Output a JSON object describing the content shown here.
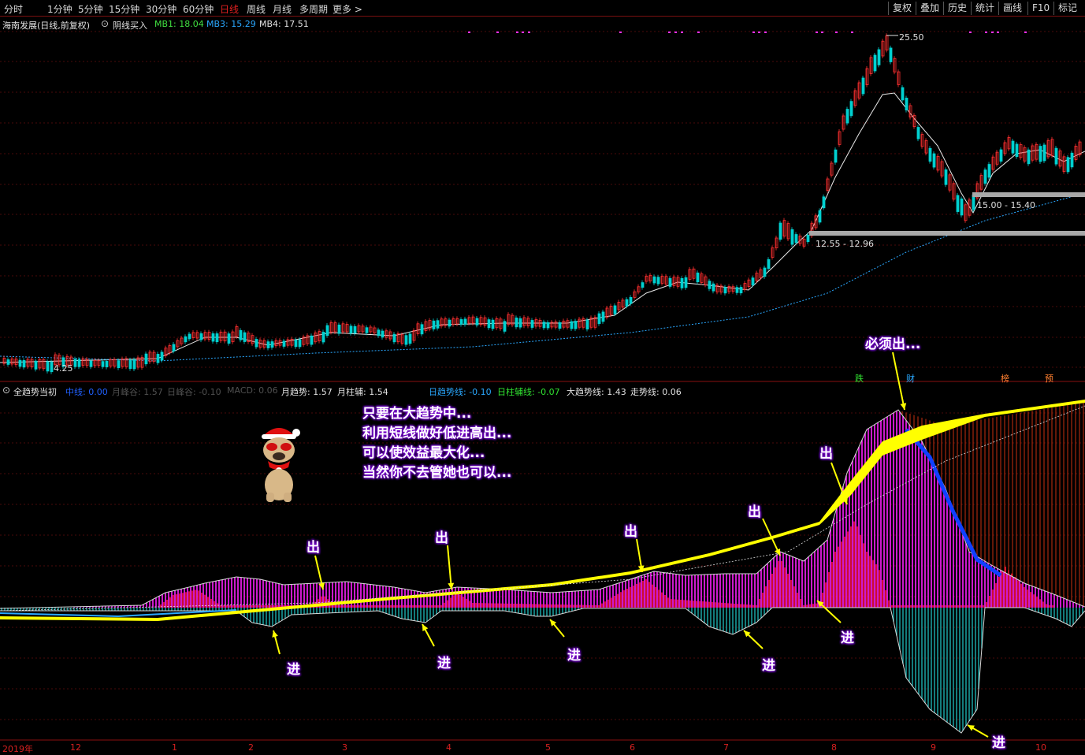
{
  "toolbar": {
    "periods": [
      "分时",
      "1分钟",
      "5分钟",
      "15分钟",
      "30分钟",
      "60分钟",
      "日线",
      "周线",
      "月线",
      "多周期",
      "更多 >"
    ],
    "active_period": "日线",
    "right_buttons": [
      "复权",
      "叠加",
      "历史",
      "统计",
      "画线",
      "F10",
      "标记"
    ]
  },
  "main_header": {
    "stock": "海南发展(日线,前复权)",
    "indicator": "阴线买入",
    "mb1": "MB1: 18.04",
    "mb3": "MB3: 15.29",
    "mb4": "MB4: 17.51"
  },
  "price_labels": {
    "high": "25.50",
    "low": "4.25",
    "zone1": "12.55 - 12.96",
    "zone2": "15.00 - 15.40"
  },
  "event_tags": [
    "跌",
    "财",
    "榜",
    "预"
  ],
  "sub_header": {
    "title": "全趋势当初",
    "zx": "中线: 0.00",
    "yfg": "月峰谷: 1.57",
    "rfg": "日峰谷: -0.10",
    "macd": "MACD: 0.06",
    "yqs": "月趋势: 1.57",
    "yzf": "月柱辅: 1.54",
    "rqsx": "日趋势线: -0.10",
    "rzfx": "日柱辅线: -0.07",
    "dqsx": "大趋势线: 1.43",
    "zsx": "走势线: 0.06"
  },
  "annotations": {
    "note_lines": [
      "只要在大趋势中...",
      "利用短线做好低进高出...",
      "可以使效益最大化...",
      "当然你不去管她也可以..."
    ],
    "must_sell": "必须出...",
    "sell": "出",
    "buy": "进"
  },
  "x_axis": {
    "year": "2019年",
    "months": [
      "12",
      "1",
      "2",
      "3",
      "4",
      "5",
      "6",
      "7",
      "8",
      "9",
      "10"
    ]
  },
  "colors": {
    "up": "#ff3030",
    "down": "#00d0d0",
    "ma_white": "#e8e8e8",
    "ma_blue": "#2aa8ff",
    "trend_yellow": "#ffff00",
    "bar_magenta": "#ff20ff",
    "bar_red": "#ff1040",
    "bar_teal": "#1a9a9a",
    "callout_purple": "#7a00d0"
  },
  "icons": [
    "mascot-dog-icon",
    "circle-dropdown-icon"
  ]
}
